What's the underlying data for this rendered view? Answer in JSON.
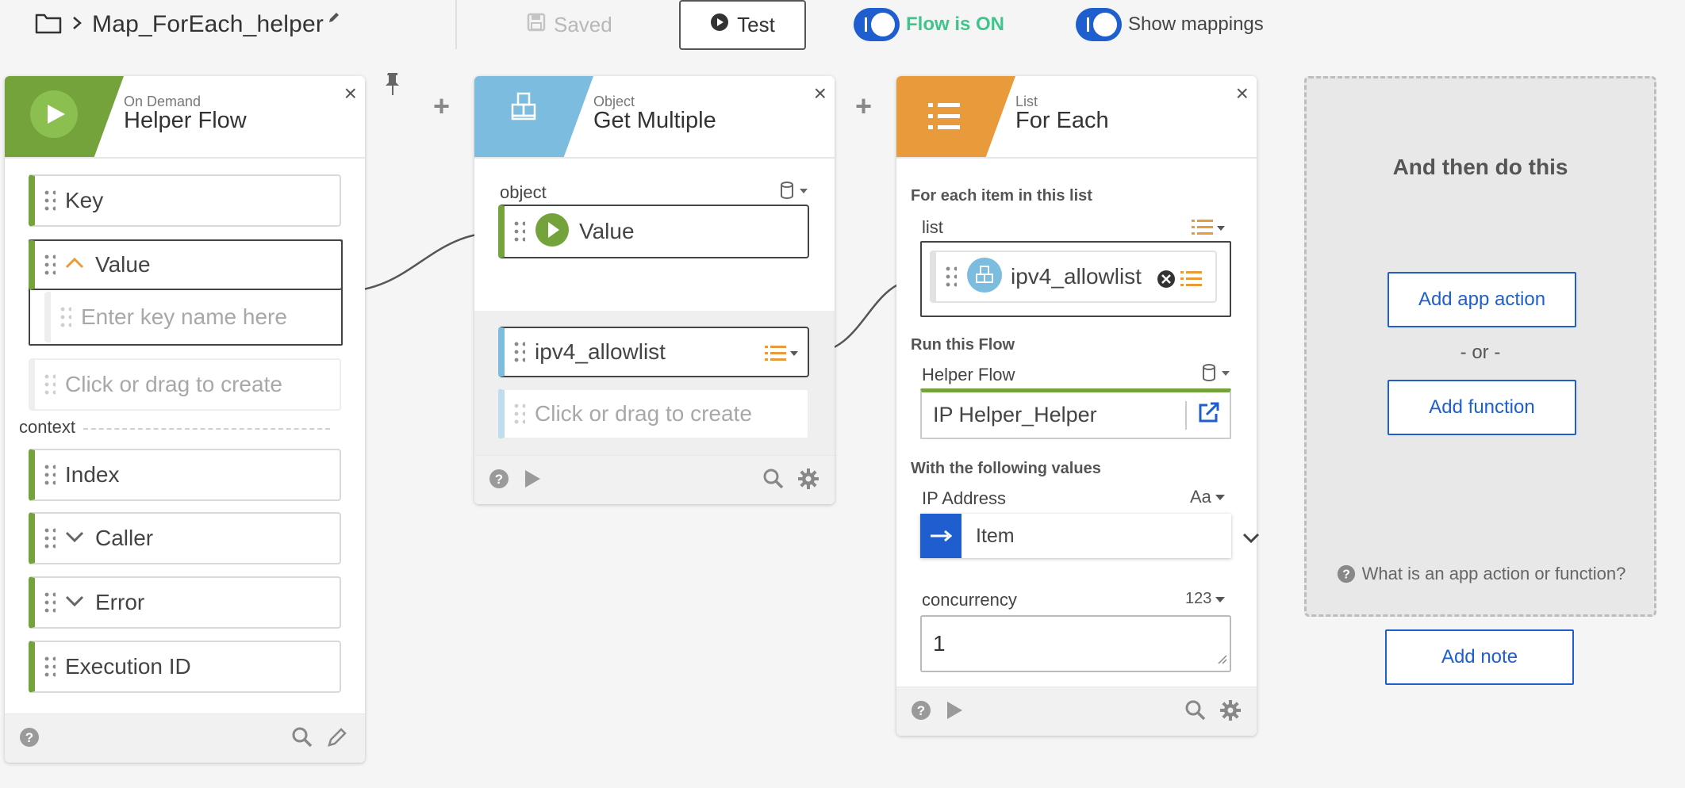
{
  "topbar": {
    "flow_name": "Map_ForEach_helper",
    "saved_label": "Saved",
    "test_label": "Test",
    "flow_on_label": "Flow is ON",
    "mappings_label": "Show mappings"
  },
  "cards": {
    "helper": {
      "subtitle": "On Demand",
      "title": "Helper Flow",
      "fields": {
        "key": "Key",
        "value": "Value",
        "placeholder_key": "Enter key name here",
        "create": "Click or drag to create",
        "context_label": "context",
        "index": "Index",
        "caller": "Caller",
        "error": "Error",
        "execution_id": "Execution ID"
      }
    },
    "object": {
      "subtitle": "Object",
      "title": "Get Multiple",
      "input_label": "object",
      "input_value": "Value",
      "output": "ipv4_allowlist",
      "create": "Click or drag to create"
    },
    "list": {
      "subtitle": "List",
      "title": "For Each",
      "for_each_heading": "For each item in this list",
      "list_label": "list",
      "list_value": "ipv4_allowlist",
      "run_heading": "Run this Flow",
      "helper_flow_label": "Helper Flow",
      "helper_flow_value": "IP Helper_Helper",
      "values_heading": "With the following values",
      "ip_label": "IP Address",
      "ip_type": "Aa",
      "ip_value": "Item",
      "concurrency_label": "concurrency",
      "concurrency_type": "123",
      "concurrency_value": "1"
    },
    "next": {
      "heading": "And then do this",
      "add_app_action": "Add app action",
      "or": "- or -",
      "add_function": "Add function",
      "help": "What is an app action or function?",
      "add_note": "Add note"
    }
  },
  "colors": {
    "accent": "#1f5ecf",
    "on_demand": "#73a33a",
    "object": "#7bbcdf",
    "list": "#e99b3c",
    "flow_on": "#3fc58c"
  }
}
